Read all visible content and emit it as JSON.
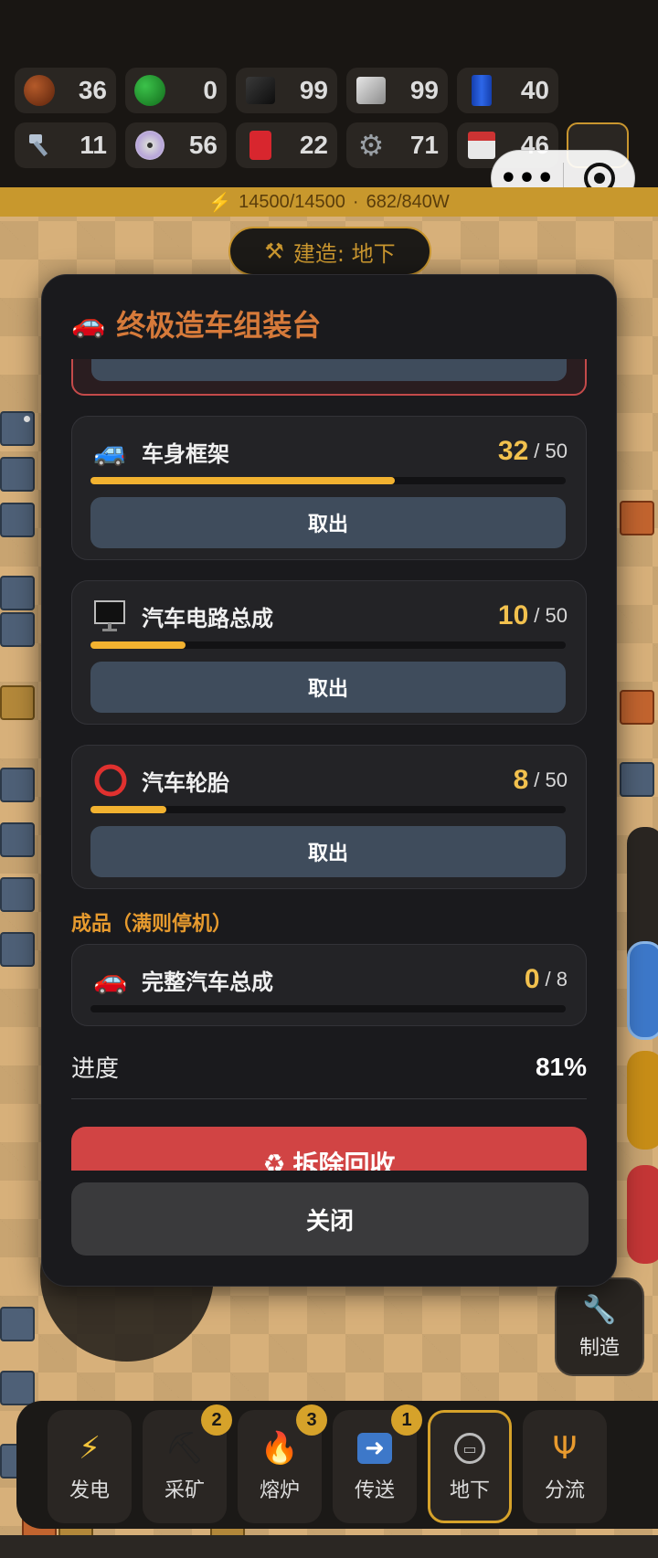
{
  "resources": {
    "row1": [
      {
        "icon": "copper-ore-icon",
        "count": "36"
      },
      {
        "icon": "green-orb-icon",
        "count": "0"
      },
      {
        "icon": "coal-block-icon",
        "count": "99"
      },
      {
        "icon": "steel-block-icon",
        "count": "99"
      },
      {
        "icon": "oil-barrel-icon",
        "count": "40"
      }
    ],
    "row2": [
      {
        "icon": "bolt-screw-icon",
        "count": "11"
      },
      {
        "icon": "disc-icon",
        "count": "56"
      },
      {
        "icon": "fuel-can-icon",
        "count": "22"
      },
      {
        "icon": "gear-icon",
        "count": "71"
      },
      {
        "icon": "floppy-disk-icon",
        "count": "46"
      }
    ]
  },
  "power": {
    "energy": "14500/14500",
    "separator": "·",
    "wattage": "682/840W"
  },
  "build_mode": {
    "label": "建造: 地下"
  },
  "modal": {
    "title": "终极造车组装台",
    "inputs": [
      {
        "icon": "blue-car-icon",
        "glyph": "🚙",
        "name": "车身框架",
        "count": "32",
        "max": "/ 50",
        "fill": 0.64,
        "button": "取出"
      },
      {
        "icon": "monitor-icon",
        "glyph": "",
        "name": "汽车电路总成",
        "count": "10",
        "max": "/ 50",
        "fill": 0.2,
        "button": "取出"
      },
      {
        "icon": "red-ring-icon",
        "glyph": "⭕",
        "name": "汽车轮胎",
        "count": "8",
        "max": "/ 50",
        "fill": 0.16,
        "button": "取出"
      }
    ],
    "output_label": "成品（满则停机）",
    "output": {
      "icon": "red-car-icon",
      "glyph": "🚗",
      "name": "完整汽车总成",
      "count": "0",
      "max": "/ 8",
      "fill": 0
    },
    "progress_label": "进度",
    "progress_value": "81%",
    "recycle_label": "拆除回收",
    "close_label": "关闭"
  },
  "side_button": {
    "label": "制造"
  },
  "toolbar": [
    {
      "icon": "lightning-icon",
      "glyph": "⚡",
      "label": "发电",
      "badge": ""
    },
    {
      "icon": "pickaxe-icon",
      "glyph": "⛏",
      "label": "采矿",
      "badge": "2"
    },
    {
      "icon": "fire-icon",
      "glyph": "🔥",
      "label": "熔炉",
      "badge": "3"
    },
    {
      "icon": "right-arrow-icon",
      "glyph": "➡",
      "label": "传送",
      "badge": "1"
    },
    {
      "icon": "metro-icon",
      "glyph": "🚇",
      "label": "地下",
      "badge": ""
    },
    {
      "icon": "trident-icon",
      "glyph": "🔱",
      "label": "分流",
      "badge": ""
    }
  ],
  "colors": {
    "accent": "#d6a22a",
    "progress": "#f2b230",
    "danger": "#d14444",
    "title": "#d67a3a"
  }
}
